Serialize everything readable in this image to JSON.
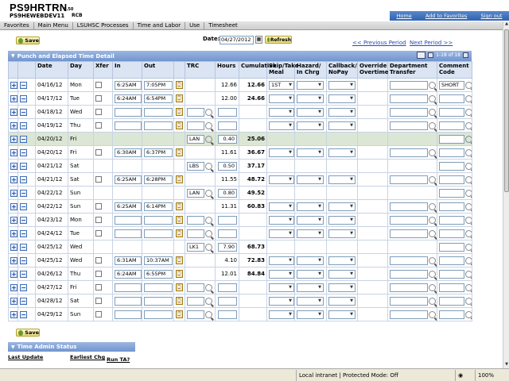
{
  "app": {
    "title": "PS9HRTRN",
    "version": "9.50",
    "db": "PS9HEWEBDEV11",
    "user": "RCB"
  },
  "toplinks": [
    "Home",
    "Add to Favorites",
    "Sign out"
  ],
  "breadcrumb": [
    "Favorites",
    "Main Menu",
    "LSUHSC Processes",
    "Time and Labor",
    "Use",
    "Timesheet"
  ],
  "buttons": {
    "save": "Save",
    "refresh": "Refresh"
  },
  "date": {
    "label": "Date:",
    "value": "04/27/2012"
  },
  "periods": {
    "prev": "<< Previous Period",
    "next": "Next Period >>"
  },
  "grid": {
    "title": "Punch and Elapsed Time Detail",
    "counter": "1-18 of 18",
    "headers": [
      "Date",
      "Day",
      "Xfer",
      "In",
      "Out",
      "TRC",
      "Hours",
      "Cumulative",
      "Skip/Take Meal",
      "Hazard/ In Chrg",
      "Callback/ NoPay",
      "Override Overtime",
      "Department Transfer",
      "Comment Code"
    ],
    "rows": [
      {
        "date": "04/16/12",
        "day": "Mon",
        "in": "6:25AM",
        "out": "7:05PM",
        "trc": "",
        "hours": "12.66",
        "cum": "12.66",
        "meal": "1ST",
        "comment": "SHORT",
        "hl": false
      },
      {
        "date": "04/17/12",
        "day": "Tue",
        "in": "6:24AM",
        "out": "6:54PM",
        "trc": "",
        "hours": "12.00",
        "cum": "24.66",
        "meal": "",
        "comment": "",
        "hl": false
      },
      {
        "date": "04/18/12",
        "day": "Wed",
        "in": "",
        "out": "",
        "trc": "",
        "hours": "",
        "cum": "",
        "meal": "",
        "comment": "",
        "hl": false
      },
      {
        "date": "04/19/12",
        "day": "Thu",
        "in": "",
        "out": "",
        "trc": "",
        "hours": "",
        "cum": "",
        "meal": "",
        "comment": "",
        "hl": false
      },
      {
        "date": "04/20/12",
        "day": "Fri",
        "in": "",
        "out": "",
        "trc": "LAN",
        "hours": "0.40",
        "cum": "25.06",
        "meal": "",
        "comment": "",
        "hl": true
      },
      {
        "date": "04/20/12",
        "day": "Fri",
        "in": "6:30AM",
        "out": "6:37PM",
        "trc": "",
        "hours": "11.61",
        "cum": "36.67",
        "meal": "",
        "comment": "",
        "hl": false
      },
      {
        "date": "04/21/12",
        "day": "Sat",
        "in": "",
        "out": "",
        "trc": "LBS",
        "hours": "0.50",
        "cum": "37.17",
        "meal": "",
        "comment": "",
        "hl": false
      },
      {
        "date": "04/21/12",
        "day": "Sat",
        "in": "6:25AM",
        "out": "6:28PM",
        "trc": "",
        "hours": "11.55",
        "cum": "48.72",
        "meal": "",
        "comment": "",
        "hl": false
      },
      {
        "date": "04/22/12",
        "day": "Sun",
        "in": "",
        "out": "",
        "trc": "LAN",
        "hours": "0.80",
        "cum": "49.52",
        "meal": "",
        "comment": "",
        "hl": false
      },
      {
        "date": "04/22/12",
        "day": "Sun",
        "in": "6:25AM",
        "out": "6:14PM",
        "trc": "",
        "hours": "11.31",
        "cum": "60.83",
        "meal": "",
        "comment": "",
        "hl": false
      },
      {
        "date": "04/23/12",
        "day": "Mon",
        "in": "",
        "out": "",
        "trc": "",
        "hours": "",
        "cum": "",
        "meal": "",
        "comment": "",
        "hl": false
      },
      {
        "date": "04/24/12",
        "day": "Tue",
        "in": "",
        "out": "",
        "trc": "",
        "hours": "",
        "cum": "",
        "meal": "",
        "comment": "",
        "hl": false
      },
      {
        "date": "04/25/12",
        "day": "Wed",
        "in": "",
        "out": "",
        "trc": "LK1",
        "hours": "7.90",
        "cum": "68.73",
        "meal": "",
        "comment": "",
        "hl": false
      },
      {
        "date": "04/25/12",
        "day": "Wed",
        "in": "6:31AM",
        "out": "10:37AM",
        "trc": "",
        "hours": "4.10",
        "cum": "72.83",
        "meal": "",
        "comment": "",
        "hl": false
      },
      {
        "date": "04/26/12",
        "day": "Thu",
        "in": "6:24AM",
        "out": "6:55PM",
        "trc": "",
        "hours": "12.01",
        "cum": "84.84",
        "meal": "",
        "comment": "",
        "hl": false
      },
      {
        "date": "04/27/12",
        "day": "Fri",
        "in": "",
        "out": "",
        "trc": "",
        "hours": "",
        "cum": "",
        "meal": "",
        "comment": "",
        "hl": false
      },
      {
        "date": "04/28/12",
        "day": "Sat",
        "in": "",
        "out": "",
        "trc": "",
        "hours": "",
        "cum": "",
        "meal": "",
        "comment": "",
        "hl": false
      },
      {
        "date": "04/29/12",
        "day": "Sun",
        "in": "",
        "out": "",
        "trc": "",
        "hours": "",
        "cum": "",
        "meal": "",
        "comment": "",
        "hl": false
      }
    ]
  },
  "time_admin": {
    "title": "Time Admin Status",
    "cols": [
      "Last Update",
      "Earliest Chg",
      "Run TA?"
    ]
  },
  "status": {
    "zone": "Local intranet | Protected Mode: Off",
    "zoom": "100%"
  }
}
